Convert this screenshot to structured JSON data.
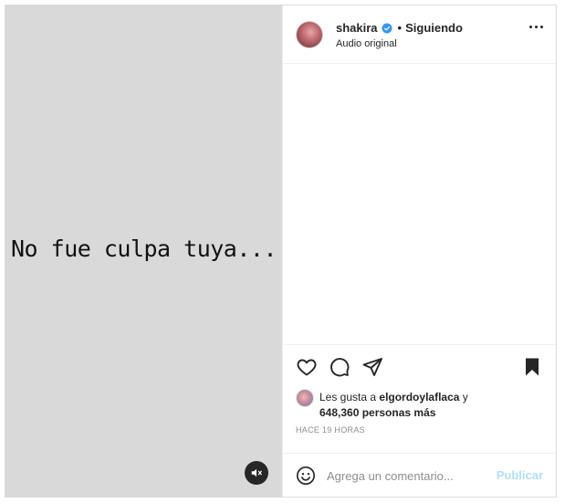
{
  "media": {
    "overlay_text": "No fue culpa tuya...",
    "mute_icon": "speaker-muted-icon"
  },
  "header": {
    "username": "shakira",
    "verified": true,
    "separator": "•",
    "follow_status": "Siguiendo",
    "audio_label": "Audio original",
    "more_icon": "more-horizontal-icon"
  },
  "actions": {
    "like_icon": "heart-icon",
    "comment_icon": "comment-bubble-icon",
    "share_icon": "paper-plane-icon",
    "save_icon": "bookmark-icon"
  },
  "likes": {
    "prefix": "Les gusta a ",
    "user": "elgordoylaflaca",
    "conjunction": " y",
    "count_text": "648,360 personas más"
  },
  "timestamp": "HACE 19 HORAS",
  "comment_box": {
    "placeholder": "Agrega un comentario...",
    "publish_label": "Publicar",
    "emoji_icon": "smiley-icon"
  },
  "colors": {
    "verified_blue": "#3897f0",
    "publish_disabled": "#b2dffc",
    "media_bg": "#d9d9d9"
  }
}
